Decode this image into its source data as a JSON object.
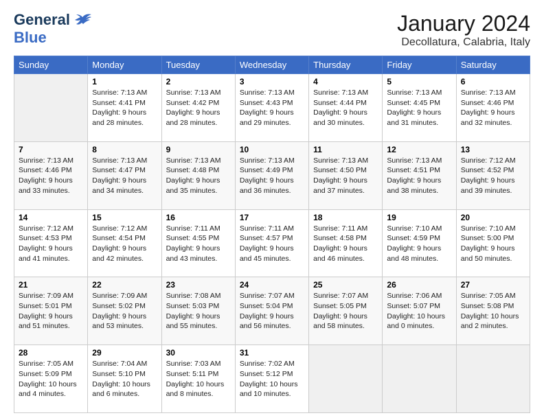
{
  "header": {
    "logo_line1": "General",
    "logo_line2": "Blue",
    "title": "January 2024",
    "subtitle": "Decollatura, Calabria, Italy"
  },
  "weekdays": [
    "Sunday",
    "Monday",
    "Tuesday",
    "Wednesday",
    "Thursday",
    "Friday",
    "Saturday"
  ],
  "weeks": [
    [
      {
        "day": "",
        "info": ""
      },
      {
        "day": "1",
        "info": "Sunrise: 7:13 AM\nSunset: 4:41 PM\nDaylight: 9 hours\nand 28 minutes."
      },
      {
        "day": "2",
        "info": "Sunrise: 7:13 AM\nSunset: 4:42 PM\nDaylight: 9 hours\nand 28 minutes."
      },
      {
        "day": "3",
        "info": "Sunrise: 7:13 AM\nSunset: 4:43 PM\nDaylight: 9 hours\nand 29 minutes."
      },
      {
        "day": "4",
        "info": "Sunrise: 7:13 AM\nSunset: 4:44 PM\nDaylight: 9 hours\nand 30 minutes."
      },
      {
        "day": "5",
        "info": "Sunrise: 7:13 AM\nSunset: 4:45 PM\nDaylight: 9 hours\nand 31 minutes."
      },
      {
        "day": "6",
        "info": "Sunrise: 7:13 AM\nSunset: 4:46 PM\nDaylight: 9 hours\nand 32 minutes."
      }
    ],
    [
      {
        "day": "7",
        "info": "Sunrise: 7:13 AM\nSunset: 4:46 PM\nDaylight: 9 hours\nand 33 minutes."
      },
      {
        "day": "8",
        "info": "Sunrise: 7:13 AM\nSunset: 4:47 PM\nDaylight: 9 hours\nand 34 minutes."
      },
      {
        "day": "9",
        "info": "Sunrise: 7:13 AM\nSunset: 4:48 PM\nDaylight: 9 hours\nand 35 minutes."
      },
      {
        "day": "10",
        "info": "Sunrise: 7:13 AM\nSunset: 4:49 PM\nDaylight: 9 hours\nand 36 minutes."
      },
      {
        "day": "11",
        "info": "Sunrise: 7:13 AM\nSunset: 4:50 PM\nDaylight: 9 hours\nand 37 minutes."
      },
      {
        "day": "12",
        "info": "Sunrise: 7:13 AM\nSunset: 4:51 PM\nDaylight: 9 hours\nand 38 minutes."
      },
      {
        "day": "13",
        "info": "Sunrise: 7:12 AM\nSunset: 4:52 PM\nDaylight: 9 hours\nand 39 minutes."
      }
    ],
    [
      {
        "day": "14",
        "info": "Sunrise: 7:12 AM\nSunset: 4:53 PM\nDaylight: 9 hours\nand 41 minutes."
      },
      {
        "day": "15",
        "info": "Sunrise: 7:12 AM\nSunset: 4:54 PM\nDaylight: 9 hours\nand 42 minutes."
      },
      {
        "day": "16",
        "info": "Sunrise: 7:11 AM\nSunset: 4:55 PM\nDaylight: 9 hours\nand 43 minutes."
      },
      {
        "day": "17",
        "info": "Sunrise: 7:11 AM\nSunset: 4:57 PM\nDaylight: 9 hours\nand 45 minutes."
      },
      {
        "day": "18",
        "info": "Sunrise: 7:11 AM\nSunset: 4:58 PM\nDaylight: 9 hours\nand 46 minutes."
      },
      {
        "day": "19",
        "info": "Sunrise: 7:10 AM\nSunset: 4:59 PM\nDaylight: 9 hours\nand 48 minutes."
      },
      {
        "day": "20",
        "info": "Sunrise: 7:10 AM\nSunset: 5:00 PM\nDaylight: 9 hours\nand 50 minutes."
      }
    ],
    [
      {
        "day": "21",
        "info": "Sunrise: 7:09 AM\nSunset: 5:01 PM\nDaylight: 9 hours\nand 51 minutes."
      },
      {
        "day": "22",
        "info": "Sunrise: 7:09 AM\nSunset: 5:02 PM\nDaylight: 9 hours\nand 53 minutes."
      },
      {
        "day": "23",
        "info": "Sunrise: 7:08 AM\nSunset: 5:03 PM\nDaylight: 9 hours\nand 55 minutes."
      },
      {
        "day": "24",
        "info": "Sunrise: 7:07 AM\nSunset: 5:04 PM\nDaylight: 9 hours\nand 56 minutes."
      },
      {
        "day": "25",
        "info": "Sunrise: 7:07 AM\nSunset: 5:05 PM\nDaylight: 9 hours\nand 58 minutes."
      },
      {
        "day": "26",
        "info": "Sunrise: 7:06 AM\nSunset: 5:07 PM\nDaylight: 10 hours\nand 0 minutes."
      },
      {
        "day": "27",
        "info": "Sunrise: 7:05 AM\nSunset: 5:08 PM\nDaylight: 10 hours\nand 2 minutes."
      }
    ],
    [
      {
        "day": "28",
        "info": "Sunrise: 7:05 AM\nSunset: 5:09 PM\nDaylight: 10 hours\nand 4 minutes."
      },
      {
        "day": "29",
        "info": "Sunrise: 7:04 AM\nSunset: 5:10 PM\nDaylight: 10 hours\nand 6 minutes."
      },
      {
        "day": "30",
        "info": "Sunrise: 7:03 AM\nSunset: 5:11 PM\nDaylight: 10 hours\nand 8 minutes."
      },
      {
        "day": "31",
        "info": "Sunrise: 7:02 AM\nSunset: 5:12 PM\nDaylight: 10 hours\nand 10 minutes."
      },
      {
        "day": "",
        "info": ""
      },
      {
        "day": "",
        "info": ""
      },
      {
        "day": "",
        "info": ""
      }
    ]
  ]
}
